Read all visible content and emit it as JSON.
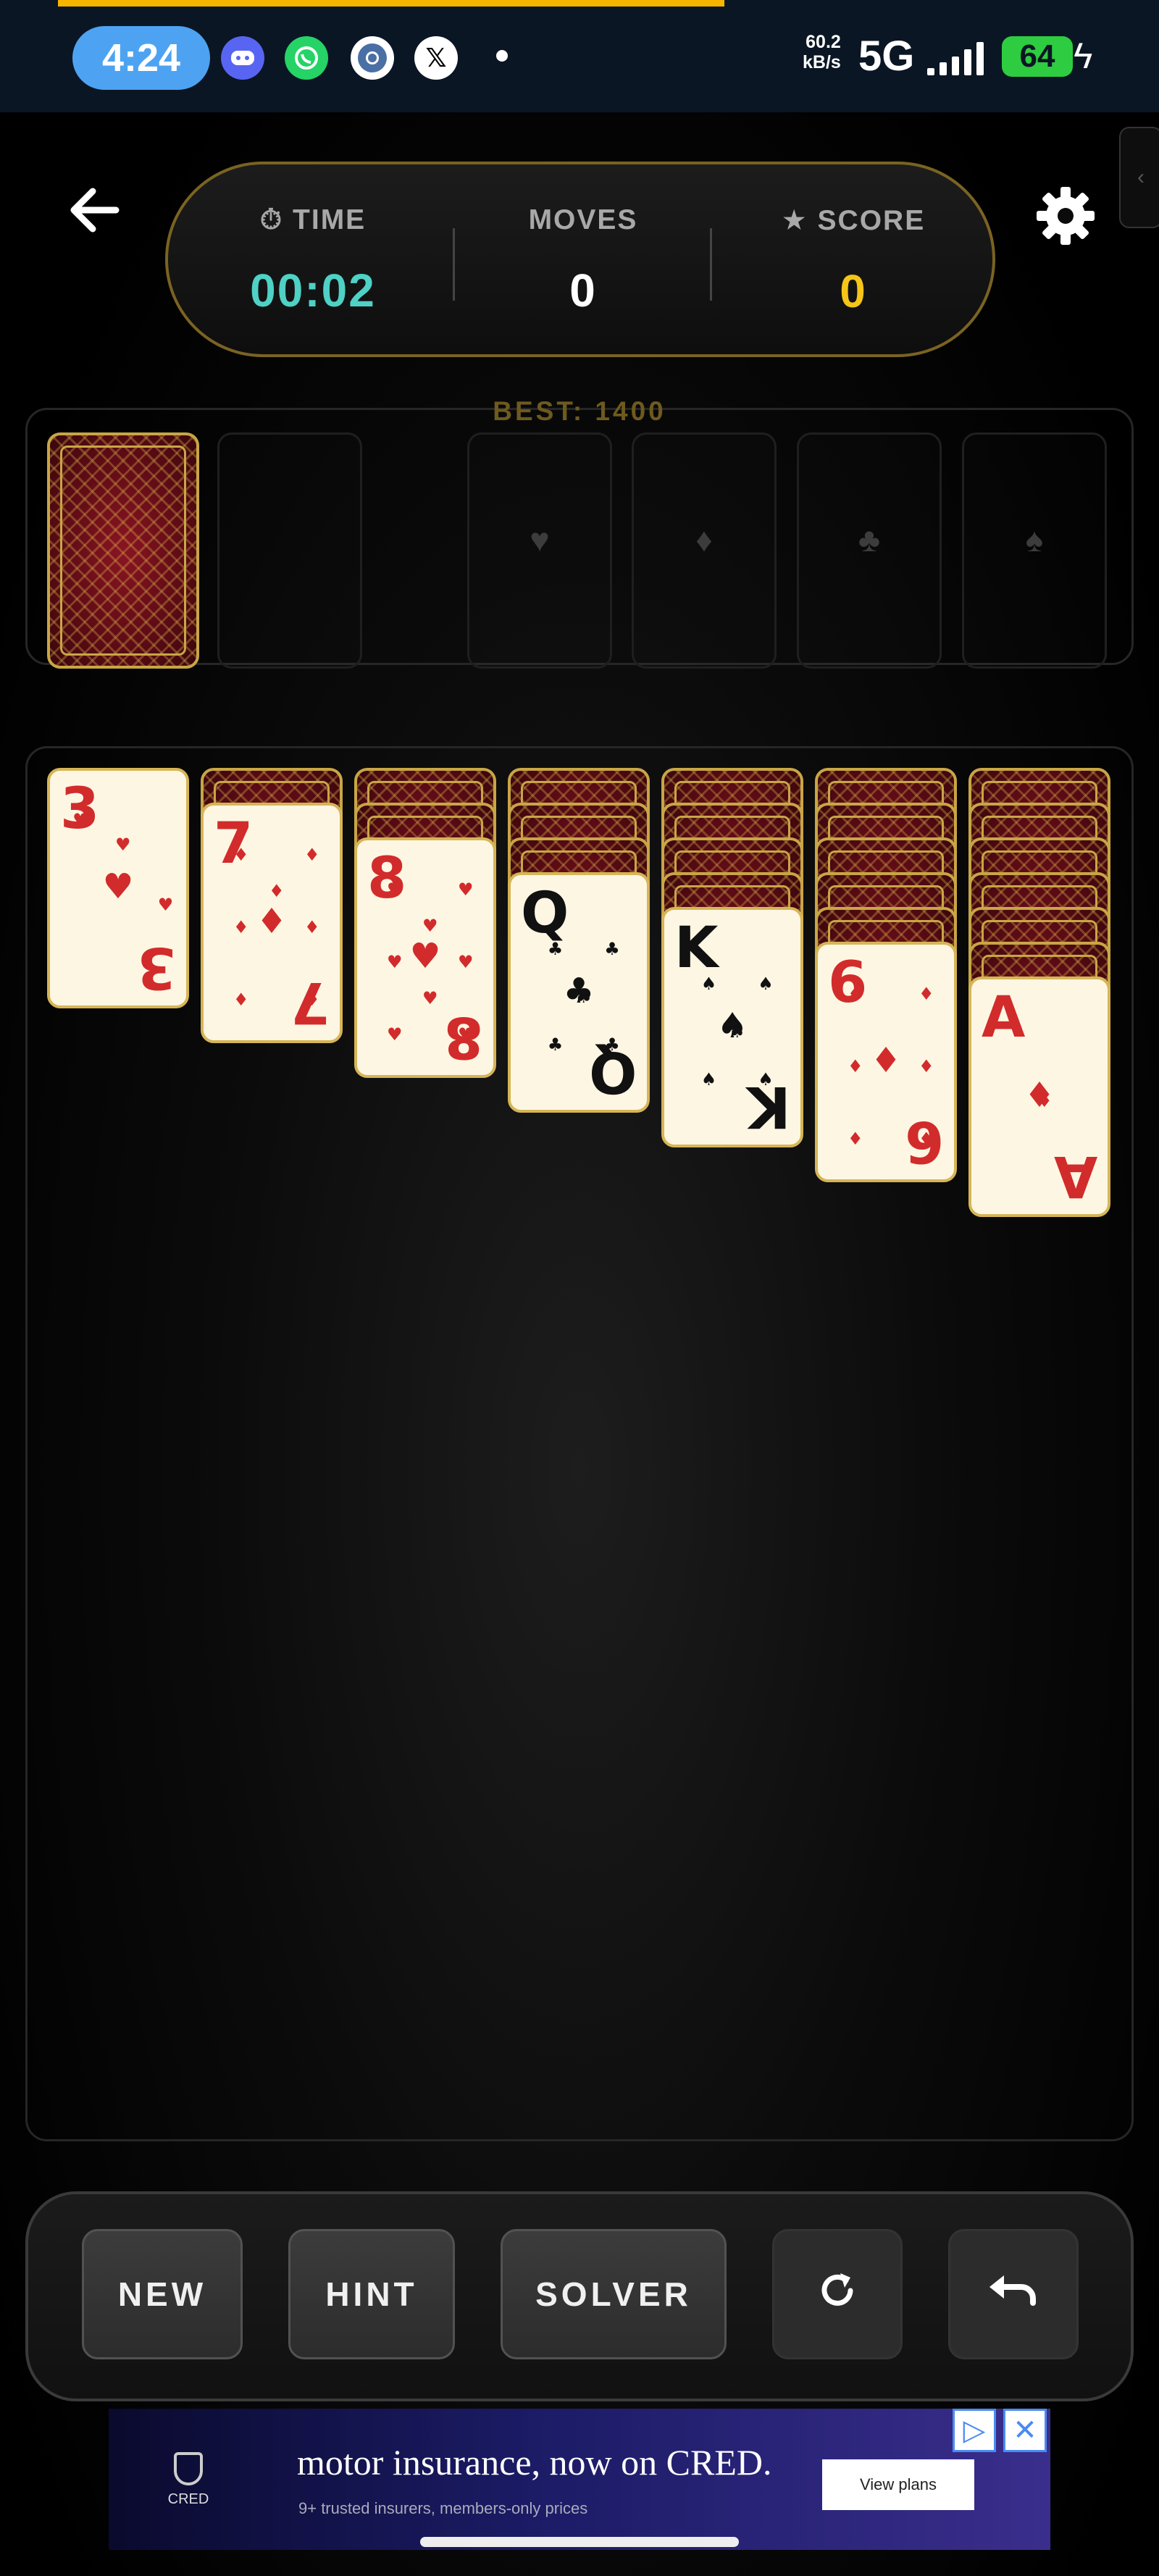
{
  "status_bar": {
    "time": "4:24",
    "icons": [
      "discord-icon",
      "whatsapp-icon",
      "chrome-icon",
      "x-icon",
      "dot-icon"
    ],
    "net_speed_value": "60.2",
    "net_speed_unit": "kB/s",
    "network": "5G",
    "battery": "64",
    "colors": {
      "bar": "#0b1624",
      "clock_pill": "#4da3f2",
      "battery": "#2ecc40"
    }
  },
  "scoreboard": {
    "time_label": "⏱ TIME",
    "time_value": "00:02",
    "moves_label": "MOVES",
    "moves_value": "0",
    "score_label": "★ SCORE",
    "score_value": "0",
    "best": "BEST: 1400",
    "colors": {
      "time": "#4fd1c5",
      "moves": "#ffffff",
      "score": "#f5c518",
      "frame": "#7a6322"
    }
  },
  "foundations": [
    "♥",
    "♦",
    "♣",
    "♠"
  ],
  "tableau": [
    {
      "face_down": 0,
      "rank": "3",
      "suit": "♥",
      "color": "red"
    },
    {
      "face_down": 1,
      "rank": "7",
      "suit": "♦",
      "color": "red"
    },
    {
      "face_down": 2,
      "rank": "8",
      "suit": "♥",
      "color": "red"
    },
    {
      "face_down": 3,
      "rank": "Q",
      "suit": "♣",
      "color": "black"
    },
    {
      "face_down": 4,
      "rank": "K",
      "suit": "♠",
      "color": "black"
    },
    {
      "face_down": 5,
      "rank": "6",
      "suit": "♦",
      "color": "red"
    },
    {
      "face_down": 6,
      "rank": "A",
      "suit": "♦",
      "color": "red"
    }
  ],
  "controls": {
    "new": "NEW",
    "hint": "HINT",
    "solver": "SOLVER",
    "restart_icon": "restart-icon",
    "undo_icon": "undo-icon"
  },
  "ad": {
    "logo": "CRED",
    "title": "motor insurance, now on CRED.",
    "subtitle": "9+ trusted insurers, members-only prices",
    "cta": "View plans"
  }
}
